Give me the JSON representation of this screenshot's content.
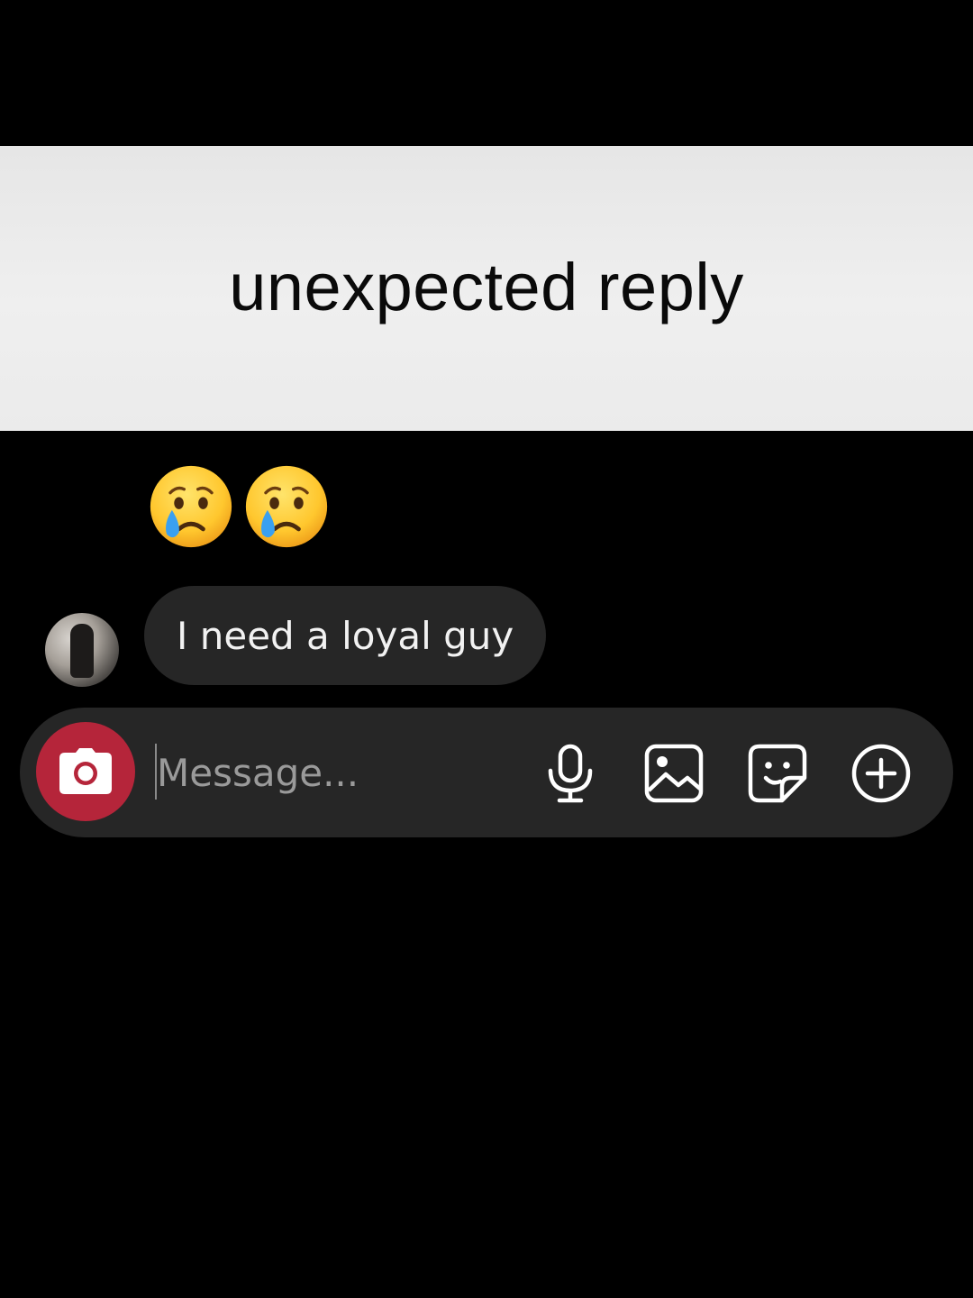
{
  "caption": {
    "text": "unexpected reply"
  },
  "emojis": [
    {
      "icon": "crying-face-emoji"
    },
    {
      "icon": "crying-face-emoji"
    }
  ],
  "thread": {
    "message_text": "I need a loyal guy"
  },
  "composer": {
    "placeholder": "Message...",
    "value": "",
    "icons": [
      "camera-icon",
      "microphone-icon",
      "gallery-icon",
      "sticker-icon",
      "plus-circle-icon"
    ]
  },
  "colors": {
    "background": "#000000",
    "bubble": "#262626",
    "camera_button": "#b5253a",
    "caption_band": "#eaeaea"
  }
}
